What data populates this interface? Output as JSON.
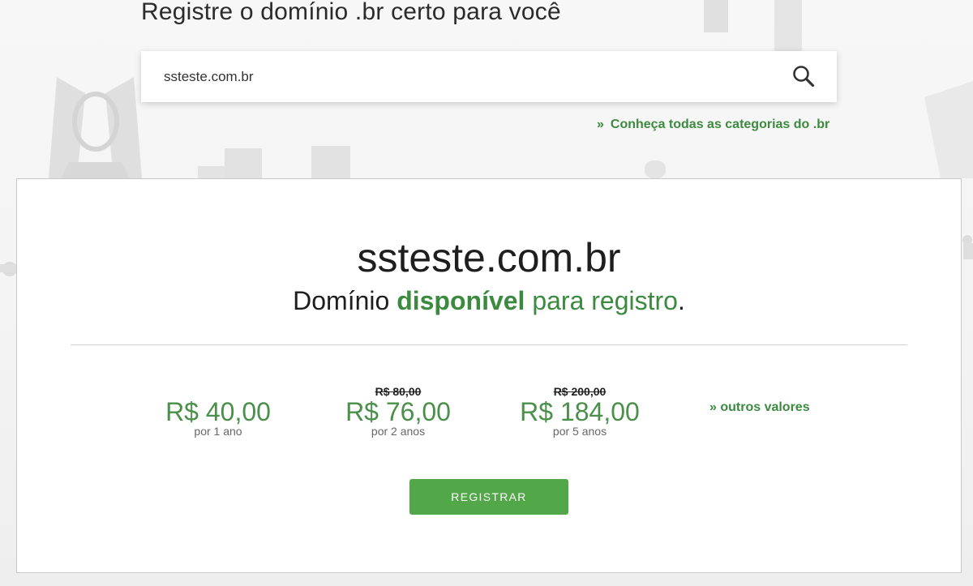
{
  "hero": {
    "title": "Registre o domínio .br certo para você"
  },
  "search": {
    "value": "ssteste.com.br",
    "button_icon": "search-icon"
  },
  "categories_link": {
    "marker": "»",
    "label": "Conheça todas as categorias do .br"
  },
  "result": {
    "domain": "ssteste.com.br",
    "status_prefix": "Domínio ",
    "status_highlight": "disponível",
    "status_suffix": " para registro",
    "status_end": "."
  },
  "prices": [
    {
      "old": "",
      "value": "R$ 40,00",
      "period": "por 1 ano"
    },
    {
      "old": "R$ 80,00",
      "value": "R$ 76,00",
      "period": "por 2 anos"
    },
    {
      "old": "R$ 200,00",
      "value": "R$ 184,00",
      "period": "por 5 anos"
    }
  ],
  "other_values_link": "» outros valores",
  "register_button": "REGISTRAR",
  "colors": {
    "accent_green": "#3c8a3f",
    "button_green": "#52a748",
    "price_green": "#4a8f4a"
  }
}
